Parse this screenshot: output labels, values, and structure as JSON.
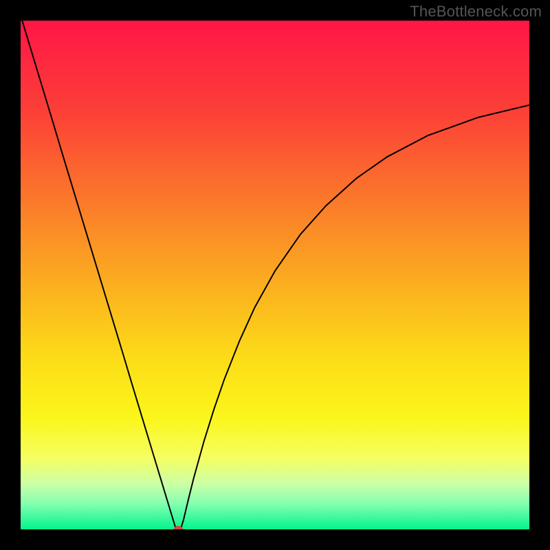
{
  "watermark": "TheBottleneck.com",
  "chart_data": {
    "type": "line",
    "title": "",
    "xlabel": "",
    "ylabel": "",
    "xlim": [
      0,
      100
    ],
    "ylim": [
      0,
      100
    ],
    "background_gradient": {
      "stops": [
        {
          "offset": 0.0,
          "color": "#ff1646"
        },
        {
          "offset": 0.18,
          "color": "#fc4037"
        },
        {
          "offset": 0.36,
          "color": "#fb7b2a"
        },
        {
          "offset": 0.52,
          "color": "#fbaf1f"
        },
        {
          "offset": 0.66,
          "color": "#fcdb18"
        },
        {
          "offset": 0.78,
          "color": "#fbf61a"
        },
        {
          "offset": 0.86,
          "color": "#f5ff62"
        },
        {
          "offset": 0.91,
          "color": "#ccffa6"
        },
        {
          "offset": 0.95,
          "color": "#83ffb0"
        },
        {
          "offset": 1.0,
          "color": "#02f48d"
        }
      ]
    },
    "series": [
      {
        "name": "bottleneck-curve",
        "color": "#000000",
        "x": [
          0,
          2,
          4,
          6,
          8,
          10,
          12,
          14,
          16,
          18,
          20,
          22,
          24,
          26,
          28,
          29,
          30,
          30.5,
          31.5,
          32,
          33,
          34,
          36,
          38,
          40,
          43,
          46,
          50,
          55,
          60,
          66,
          72,
          80,
          90,
          100
        ],
        "y": [
          101,
          94.4,
          87.8,
          81.2,
          74.5,
          67.9,
          61.3,
          54.7,
          48.1,
          41.5,
          34.9,
          28.2,
          21.6,
          15.0,
          8.4,
          5.1,
          1.8,
          0.2,
          0.2,
          1.8,
          6.0,
          10.0,
          17.2,
          23.6,
          29.4,
          37.0,
          43.6,
          50.8,
          58.0,
          63.6,
          69.0,
          73.2,
          77.4,
          81.0,
          83.4
        ]
      }
    ],
    "marker": {
      "x": 31.0,
      "y": 0.0,
      "rx": 0.9,
      "ry": 0.7,
      "color": "#d04a3a"
    }
  }
}
